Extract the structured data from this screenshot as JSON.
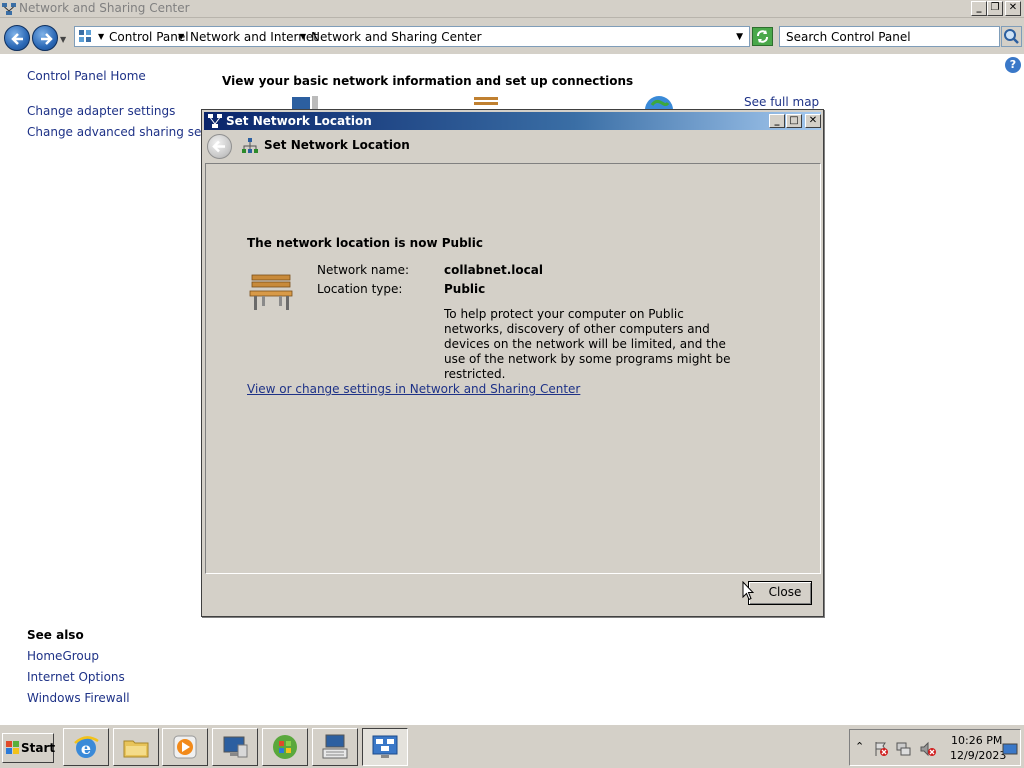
{
  "window": {
    "title": "Network and Sharing Center"
  },
  "address_bar": {
    "crumbs": [
      "Control Panel",
      "Network and Internet",
      "Network and Sharing Center"
    ],
    "search_placeholder": "Search Control Panel"
  },
  "left_pane": {
    "home": "Control Panel Home",
    "links": [
      "Change adapter settings",
      "Change advanced sharing settings"
    ],
    "see_also_title": "See also",
    "see_also": [
      "HomeGroup",
      "Internet Options",
      "Windows Firewall"
    ]
  },
  "main": {
    "heading": "View your basic network information and set up connections",
    "see_full_map": "See full map"
  },
  "dialog": {
    "title": "Set Network Location",
    "header": "Set Network Location",
    "status": "The network location is now Public",
    "network_name_label": "Network name:",
    "network_name_value": "collabnet.local",
    "location_type_label": "Location type:",
    "location_type_value": "Public",
    "description": "To help protect your computer on Public networks, discovery of other computers and devices on the network will be limited, and the use of the network by some programs might be restricted.",
    "link": "View or change settings in Network and Sharing Center",
    "close_label": "Close"
  },
  "taskbar": {
    "start_label": "Start",
    "clock_time": "10:26 PM",
    "clock_date": "12/9/2023"
  }
}
